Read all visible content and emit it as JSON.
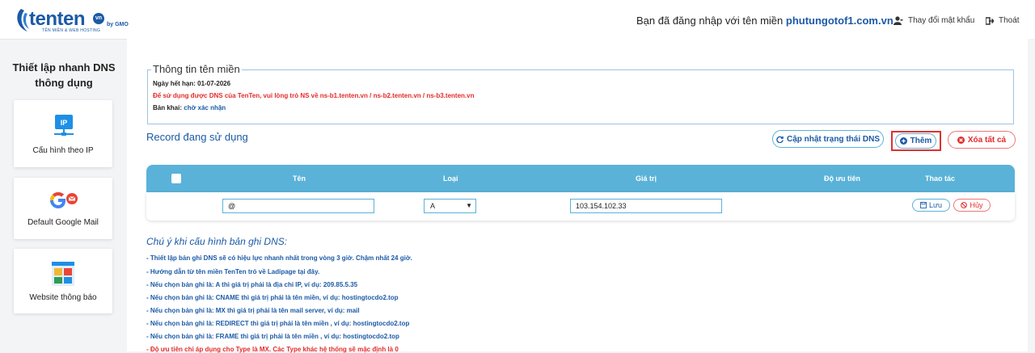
{
  "header": {
    "logo_text": "tenten",
    "logo_badge": "vn",
    "logo_tagline": "TÊN MIỀN & WEB HOSTING",
    "logo_brand": "by GMO",
    "login_prefix": "Bạn đã đăng nhập với tên miền",
    "login_domain": "phutungotof1.com.vn",
    "change_password": "Thay đổi mật khẩu",
    "logout": "Thoát"
  },
  "sidebar": {
    "title_line1": "Thiết lập nhanh DNS",
    "title_line2": "thông dụng",
    "cards": [
      {
        "label": "Cấu hình theo IP",
        "icon": "ip-network-icon"
      },
      {
        "label": "Default Google Mail",
        "icon": "google-mail-icon"
      },
      {
        "label": "Website thông báo",
        "icon": "website-icon"
      }
    ]
  },
  "domain_info": {
    "legend": "Thông tin tên miền",
    "expiry": "Ngày hết hạn: 01-07-2026",
    "ns_notice": "Để sử dụng được DNS của TenTen, vui lòng trỏ NS về ns-b1.tenten.vn / ns-b2.tenten.vn / ns-b3.tenten.vn",
    "deploy_label": "Bản khai:",
    "deploy_status": "chờ xác nhận"
  },
  "records": {
    "title": "Record đang sử dụng",
    "btn_update": "Cập nhật trạng thái DNS",
    "btn_add": "Thêm",
    "btn_clear": "Xóa tất cả",
    "columns": [
      "Tên",
      "Loại",
      "Giá trị",
      "Độ ưu tiên",
      "Thao tác"
    ],
    "row": {
      "name": "@",
      "type": "A",
      "value": "103.154.102.33",
      "save": "Lưu",
      "cancel": "Hủy"
    }
  },
  "notes": {
    "title": "Chú ý khi cấu hình bản ghi DNS:",
    "items": [
      "- Thiết lập bản ghi DNS sẽ có hiệu lực nhanh nhất trong vòng 3 giờ. Chậm nhất 24 giờ.",
      "- Hướng dẫn từ tên miền TenTen trỏ về Ladipage tại đây.",
      "- Nếu chọn bản ghi là: A thì giá trị phải là địa chỉ IP, ví dụ: 209.85.5.35",
      "- Nếu chọn bản ghi là: CNAME thì giá trị phải là tên miền, ví dụ: hostingtocdo2.top",
      "- Nếu chọn bản ghi là: MX thì giá trị phải là tên mail server, ví dụ: mail",
      "- Nếu chọn bản ghi là: REDIRECT thì giá trị phải là tên miền , ví dụ: hostingtocdo2.top",
      "- Nếu chọn bản ghi là: FRAME thì giá trị phải là tên miền , ví dụ: hostingtocdo2.top",
      "- Độ ưu tiên chỉ áp dụng cho Type là MX. Các Type khác hệ thống sẽ mặc định là 0"
    ]
  },
  "colors": {
    "brand_blue": "#1b5aa6",
    "table_header": "#5ab2d8",
    "danger_red": "#e32b2b"
  }
}
